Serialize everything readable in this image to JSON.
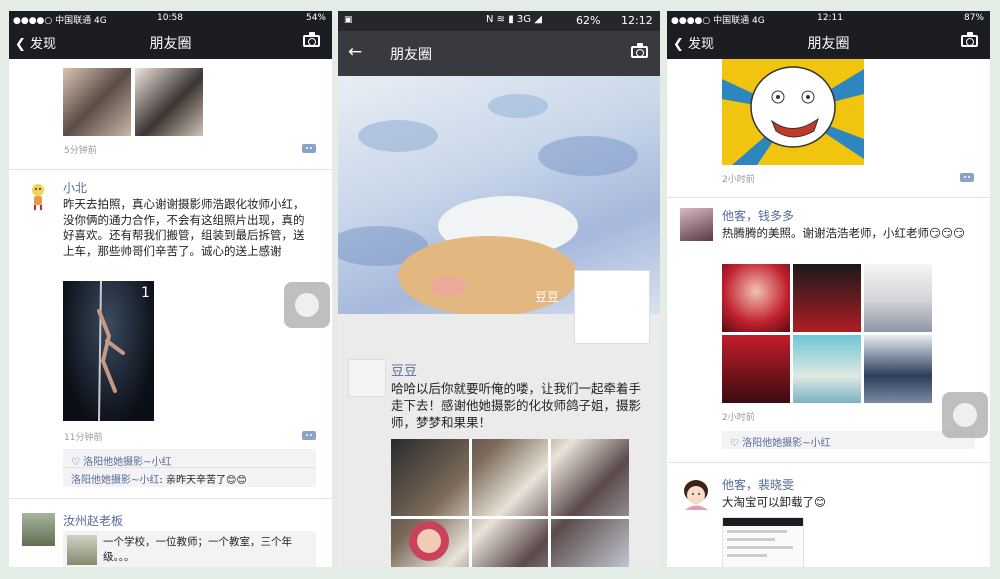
{
  "p1": {
    "carrier": "●●●●○ 中国联通 4G",
    "time": "10:58",
    "battery": "54%",
    "back": "发现",
    "title": "朋友圈",
    "post1_time": "5分钟前",
    "post2_name": "小北",
    "post2_text": "昨天去拍照，真心谢谢摄影师浩跟化妆师小红，没你俩的通力合作，不会有这组照片出现，真的好喜欢。还有帮我们搬管，组装到最后拆管，送上车，那些帅哥们辛苦了。诚心的送上感谢",
    "post2_time": "11分钟前",
    "post2_likes": "洛阳他她摄影~小红",
    "post2_comment_name": "洛阳他她摄影~小红",
    "post2_comment_text": ": 亲昨天辛苦了😊😊",
    "post3_name": "汝州赵老板",
    "post3_text": "一个学校，一位教师；一个教室，三个年级。。。"
  },
  "p2": {
    "time": "12:12",
    "battery": "62%",
    "title": "朋友圈",
    "cover_name": "豆豆",
    "post_name": "豆豆",
    "post_text": "哈哈以后你就要听俺的喽，让我们一起牵着手走下去！感谢他她摄影的化妆师鸽子姐，摄影师，梦梦和果果！"
  },
  "p3": {
    "carrier": "●●●●○ 中国联通 4G",
    "time": "12:11",
    "battery": "87%",
    "back": "发现",
    "title": "朋友圈",
    "post1_time": "2小时前",
    "post2_name": "他客，钱多多",
    "post2_text": "热腾腾的美照。谢谢浩浩老师，小红老师😏😏😏",
    "post2_time": "2小时前",
    "post2_likes": "洛阳他她摄影~小红",
    "post3_name": "他客，裴晓雯",
    "post3_text": "大淘宝可以卸载了😊"
  },
  "colors": {
    "accent": "#576b95",
    "bar": "#1c1d22"
  }
}
